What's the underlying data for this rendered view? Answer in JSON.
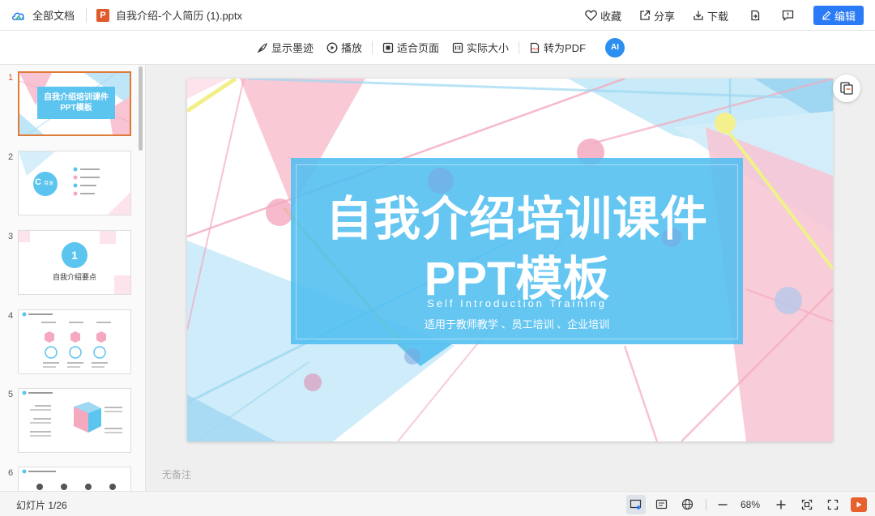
{
  "topbar": {
    "all_docs_label": "全部文档",
    "file_type_icon": "P",
    "document_title": "自我介绍-个人简历 (1).pptx",
    "favorite_label": "收藏",
    "share_label": "分享",
    "download_label": "下载",
    "edit_label": "编辑"
  },
  "toolbar": {
    "show_ink_label": "显示墨迹",
    "play_label": "播放",
    "fit_page_label": "适合页面",
    "actual_size_label": "实际大小",
    "to_pdf_label": "转为PDF",
    "ai_label": "AI"
  },
  "sidebar": {
    "thumbnails": [
      {
        "number": "1",
        "title": "自我介绍培训课件",
        "subtitle": "PPT模板"
      },
      {
        "number": "2",
        "badge": "C",
        "title": "目录"
      },
      {
        "number": "3",
        "badge": "1",
        "title": "自我介绍要点"
      },
      {
        "number": "4"
      },
      {
        "number": "5"
      },
      {
        "number": "6"
      }
    ]
  },
  "slide": {
    "title_line1": "自我介绍培训课件",
    "title_line2": "PPT模板",
    "subtitle_en": "Self Introduction Training",
    "subtitle_cn": "适用于教师教学 、员工培训 、企业培训"
  },
  "notes": {
    "placeholder": "无备注"
  },
  "statusbar": {
    "slide_counter": "幻灯片 1/26",
    "zoom_level": "68%"
  },
  "colors": {
    "accent_blue": "#2b7bf6",
    "banner_blue": "#50bef0",
    "pink": "#f4a9bf",
    "orange": "#e05a2b"
  }
}
